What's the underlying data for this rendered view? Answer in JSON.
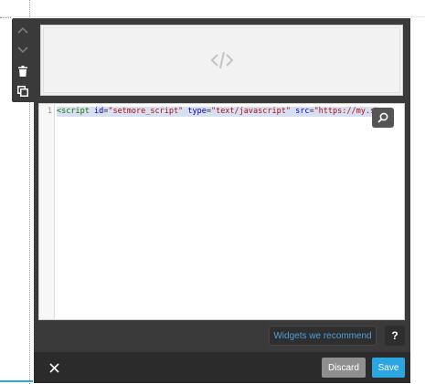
{
  "toolbar": {
    "move_up_icon": "chevron-up-icon",
    "move_down_icon": "chevron-down-icon",
    "delete_icon": "trash-icon",
    "duplicate_icon": "copy-icon"
  },
  "preview": {
    "icon": "code-icon"
  },
  "editor": {
    "line_number": "1",
    "tokens": {
      "t1": "<script",
      "t2": " ",
      "t3": "id",
      "t4": "=",
      "t5": "\"setmore_script\"",
      "t6": " ",
      "t7": "type",
      "t8": "=",
      "t9": "\"text/javascript\"",
      "t10": " ",
      "t11": "src",
      "t12": "=",
      "t13": "\"https://my.s"
    },
    "search_icon": "search-icon"
  },
  "actions": {
    "recommend_label": "Widgets we recommend",
    "help_label": "?",
    "close_icon": "close-icon",
    "discard_label": "Discard",
    "save_label": "Save"
  },
  "colors": {
    "panel": "#3a3a3a",
    "footer": "#2b2b2b",
    "accent": "#2aa6e3",
    "discard": "#8f8f8f",
    "link": "#4f9fd8"
  }
}
